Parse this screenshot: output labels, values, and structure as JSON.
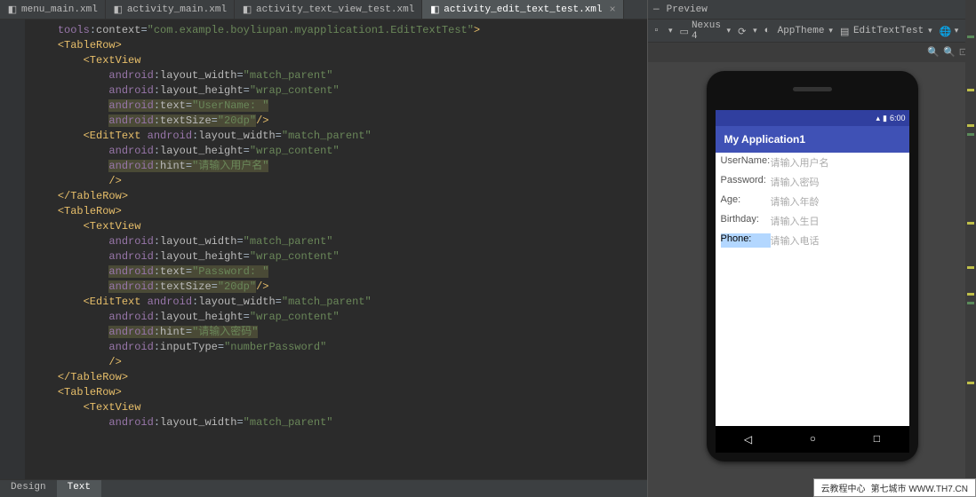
{
  "tabs": [
    {
      "label": "menu_main.xml",
      "active": false
    },
    {
      "label": "activity_main.xml",
      "active": false
    },
    {
      "label": "activity_text_view_test.xml",
      "active": false
    },
    {
      "label": "activity_edit_text_test.xml",
      "active": true
    }
  ],
  "bottom_tabs": {
    "design": "Design",
    "text": "Text"
  },
  "code": {
    "tools_context": "com.example.boyliupan.myapplication1.EditTextTest",
    "row1": {
      "tv_text": "UserName: ",
      "tv_size": "20dp",
      "et_hint": "请输入用户名"
    },
    "row2": {
      "tv_text": "Password: ",
      "tv_size": "20dp",
      "et_hint": "请输入密码",
      "et_inputType": "numberPassword"
    },
    "lw": "match_parent",
    "lh": "wrap_content"
  },
  "preview": {
    "title": "Preview",
    "device": "Nexus 4",
    "theme": "AppTheme",
    "activity": "EditTextTest",
    "status_time": "6:00",
    "app_title": "My Application1",
    "rows": [
      {
        "label": "UserName:",
        "hint": "请输入用户名",
        "sel": false
      },
      {
        "label": "Password:",
        "hint": "请输入密码",
        "sel": false
      },
      {
        "label": "Age:",
        "hint": "请输入年龄",
        "sel": false
      },
      {
        "label": "Birthday:",
        "hint": "请输入生日",
        "sel": false
      },
      {
        "label": "Phone:",
        "hint": "请输入电话",
        "sel": true
      }
    ]
  },
  "footer": {
    "left": "云教程中心",
    "right": "第七城市   WWW.TH7.CN"
  }
}
